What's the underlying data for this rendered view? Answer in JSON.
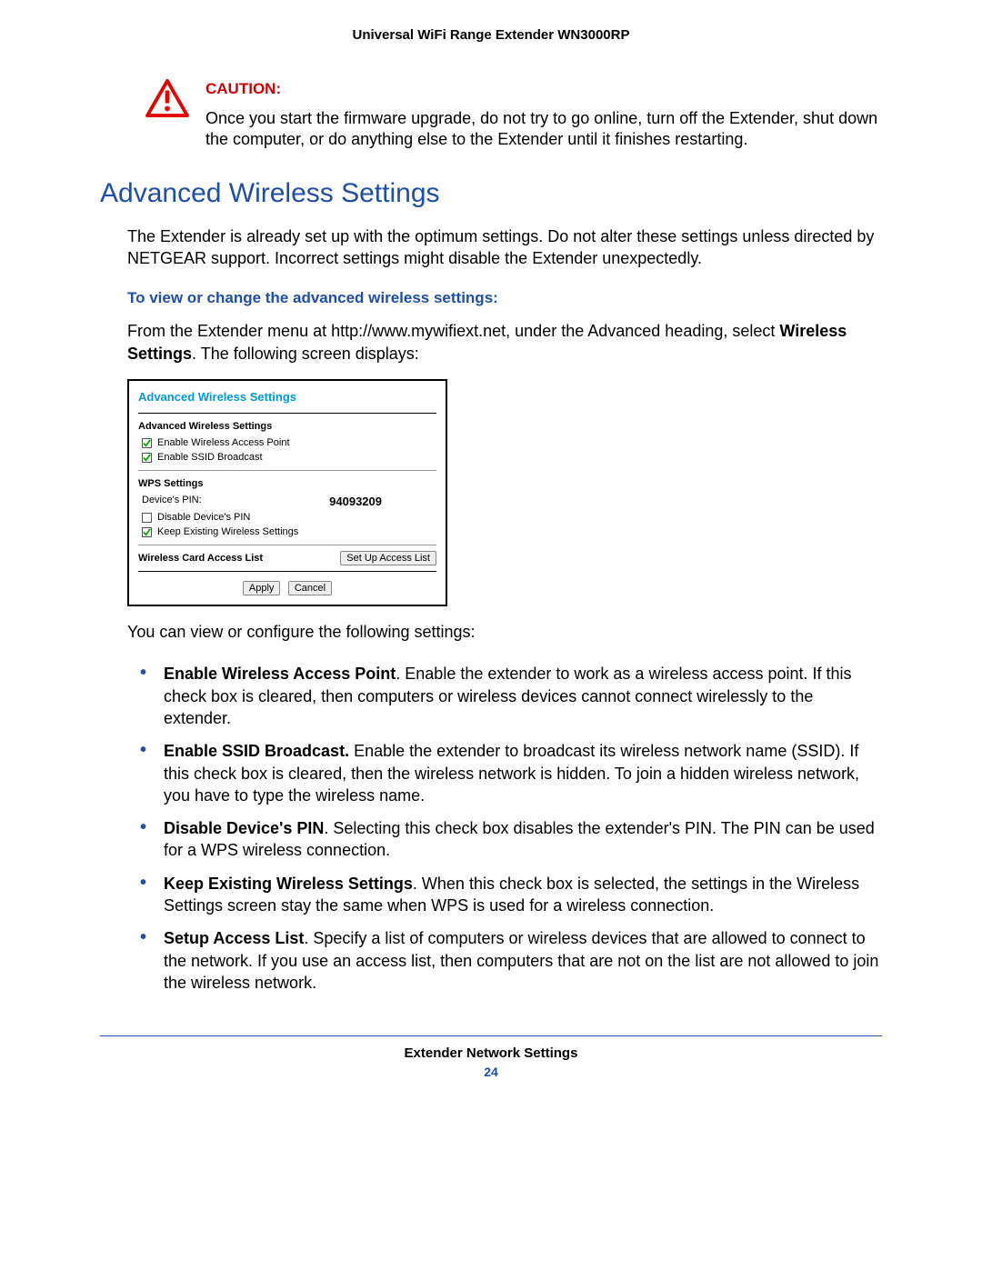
{
  "header": {
    "title": "Universal WiFi Range Extender WN3000RP"
  },
  "caution": {
    "label": "Caution:",
    "text": "Once you start the firmware upgrade, do not try to go online, turn off the Extender, shut down the computer, or do anything else to the Extender until it finishes restarting."
  },
  "section": {
    "heading": "Advanced Wireless Settings",
    "intro": "The Extender is already set up with the optimum settings. Do not alter these settings unless directed by NETGEAR support. Incorrect settings might disable the Extender unexpectedly.",
    "procedure_heading": "To view or change the advanced wireless settings:",
    "instruction_pre": "From the Extender menu at http://www.mywifiext.net, under the Advanced heading, select ",
    "instruction_bold": "Wireless Settings",
    "instruction_post": ". The following screen displays:",
    "after_shot": "You can view or configure the following settings:"
  },
  "screenshot": {
    "title": "Advanced Wireless Settings",
    "adv_label": "Advanced Wireless Settings",
    "chk_enable_ap": "Enable Wireless Access Point",
    "chk_enable_ssid": "Enable SSID Broadcast",
    "wps_label": "WPS Settings",
    "pin_label": "Device's PIN:",
    "pin_value": "94093209",
    "chk_disable_pin": "Disable Device's PIN",
    "chk_keep_existing": "Keep Existing Wireless Settings",
    "access_label": "Wireless Card Access List",
    "btn_setup_list": "Set Up Access List",
    "btn_apply": "Apply",
    "btn_cancel": "Cancel"
  },
  "bullets": [
    {
      "bold": "Enable Wireless Access Point",
      "text": ". Enable the extender to work as a wireless access point. If this check box is cleared, then computers or wireless devices cannot connect wirelessly to the extender."
    },
    {
      "bold": "Enable SSID Broadcast.",
      "text": " Enable the extender to broadcast its wireless network name (SSID). If this check box is cleared, then the wireless network is hidden. To join a hidden wireless network, you have to type the wireless name."
    },
    {
      "bold": "Disable Device's PIN",
      "text": ". Selecting this check box disables the extender's PIN. The PIN can be used for a WPS wireless connection."
    },
    {
      "bold": "Keep Existing Wireless Settings",
      "text": ". When this check box is selected, the settings in the Wireless Settings screen stay the same when WPS is used for a wireless connection."
    },
    {
      "bold": "Setup Access List",
      "text": ". Specify a list of computers or wireless devices that are allowed to connect to the network. If you use an access list, then computers that are not on the list are not allowed to join the wireless network."
    }
  ],
  "footer": {
    "title": "Extender Network Settings",
    "page": "24"
  }
}
